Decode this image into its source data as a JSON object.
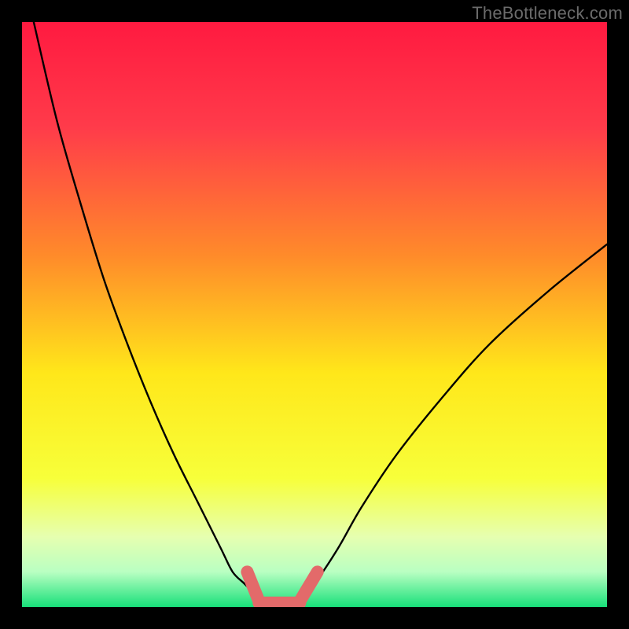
{
  "watermark": "TheBottleneck.com",
  "chart_data": {
    "type": "line",
    "title": "",
    "xlabel": "",
    "ylabel": "",
    "xlim": [
      0,
      100
    ],
    "ylim": [
      0,
      100
    ],
    "series": [
      {
        "name": "curve-left",
        "x": [
          2,
          6,
          10,
          14,
          18,
          22,
          26,
          30,
          34,
          36,
          38,
          40
        ],
        "y": [
          100,
          83,
          69,
          56,
          45,
          35,
          26,
          18,
          10,
          6,
          4,
          2
        ]
      },
      {
        "name": "curve-right",
        "x": [
          48,
          50,
          54,
          58,
          64,
          72,
          80,
          90,
          100
        ],
        "y": [
          2,
          4,
          10,
          17,
          26,
          36,
          45,
          54,
          62
        ]
      },
      {
        "name": "highlight-segments",
        "segments": [
          {
            "x0": 38.5,
            "y0": 6,
            "x1": 40.5,
            "y1": 1
          },
          {
            "x0": 40.5,
            "y0": 0.7,
            "x1": 47.5,
            "y1": 0.7
          },
          {
            "x0": 47.5,
            "y0": 1,
            "x1": 50.5,
            "y1": 6
          }
        ]
      }
    ],
    "gradient": {
      "stops": [
        {
          "offset": 0.0,
          "color": "#ff1a40"
        },
        {
          "offset": 0.18,
          "color": "#ff3b4a"
        },
        {
          "offset": 0.4,
          "color": "#ff8b2a"
        },
        {
          "offset": 0.6,
          "color": "#ffe71a"
        },
        {
          "offset": 0.78,
          "color": "#f7ff3a"
        },
        {
          "offset": 0.88,
          "color": "#e6ffb0"
        },
        {
          "offset": 0.94,
          "color": "#b9ffc2"
        },
        {
          "offset": 1.0,
          "color": "#18e07a"
        }
      ]
    },
    "highlight_color": "#e36a6a",
    "curve_color": "#000000"
  }
}
